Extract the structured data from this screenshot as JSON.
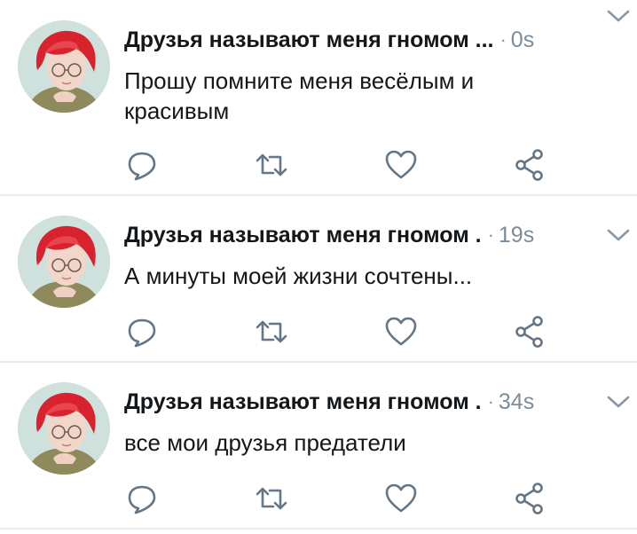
{
  "tweets": [
    {
      "author": "Друзья называют меня гномом ...",
      "time": "0s",
      "text": "Прошу помните меня весёлым и красивым"
    },
    {
      "author": "Друзья называют меня гномом .",
      "time": "19s",
      "text": "А минуты моей жизни сочтены..."
    },
    {
      "author": "Друзья называют меня гномом .",
      "time": "34s",
      "text": "все мои друзья предатели"
    }
  ],
  "separator": "·",
  "icons": {
    "avatar": "avatar-red-hair",
    "menu": "chevron-down-icon",
    "reply": "reply-icon",
    "retweet": "retweet-icon",
    "like": "heart-icon",
    "share": "share-icon"
  },
  "colors": {
    "text": "#14171a",
    "muted": "#7d8c99",
    "icon": "#657786",
    "divider": "#e6ecf0",
    "hair": "#d8232f"
  }
}
